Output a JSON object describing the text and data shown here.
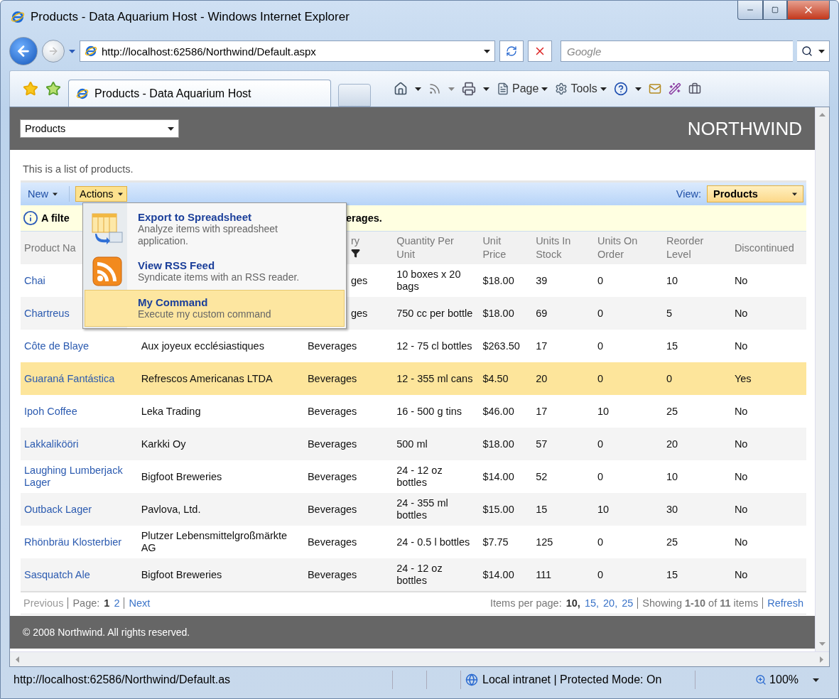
{
  "window": {
    "title": "Products - Data Aquarium Host - Windows Internet Explorer"
  },
  "address_bar": {
    "url": "http://localhost:62586/Northwind/Default.aspx"
  },
  "search": {
    "placeholder": "Google"
  },
  "tabs": [
    {
      "label": "Products - Data Aquarium Host",
      "selected": true
    }
  ],
  "command_bar": {
    "menus": [
      "Page",
      "Tools"
    ]
  },
  "page": {
    "table_picker": {
      "value": "Products"
    },
    "brand": "NORTHWIND",
    "description": "This is a list of products.",
    "toolbar": {
      "items": [
        {
          "label": "New",
          "selected": false
        },
        {
          "label": "Actions",
          "selected": true
        }
      ],
      "view_label": "View:",
      "view_value": "Products"
    },
    "actions_menu": [
      {
        "kind": "spreadsheet",
        "title": "Export to Spreadsheet",
        "description": "Analyze items with spreadsheet application.",
        "selected": false
      },
      {
        "kind": "rss",
        "title": "View RSS Feed",
        "description": "Syndicate items with an RSS reader.",
        "selected": false
      },
      {
        "kind": "plain",
        "title": "My Command",
        "description": "Execute my custom command",
        "selected": true
      }
    ],
    "filter_notice": {
      "text_start": "A filte",
      "text_end": "erages."
    },
    "table": {
      "columns": [
        {
          "label": "Product Na",
          "filtered": false
        },
        {
          "label": "ry",
          "filtered": true
        },
        {
          "label": "Quantity Per Unit",
          "filtered": false
        },
        {
          "label": "Unit Price",
          "filtered": false
        },
        {
          "label": "Units In Stock",
          "filtered": false
        },
        {
          "label": "Units On Order",
          "filtered": false
        },
        {
          "label": "Reorder Level",
          "filtered": false
        },
        {
          "label": "Discontinued",
          "filtered": false
        }
      ],
      "rows": [
        {
          "product": "Chai",
          "category": "ges",
          "quantity": "10 boxes x 20 bags",
          "price": "$18.00",
          "in_stock": "39",
          "on_order": "0",
          "reorder": "10",
          "discontinued": "No",
          "selected": false
        },
        {
          "product": "Chartreus",
          "category": "ges",
          "quantity": "750 cc per bottle",
          "price": "$18.00",
          "in_stock": "69",
          "on_order": "0",
          "reorder": "5",
          "discontinued": "No",
          "selected": false
        },
        {
          "product": "Côte de Blaye",
          "supplier": "Aux joyeux ecclésiastiques",
          "category": "Beverages",
          "quantity": "12 - 75 cl bottles",
          "price": "$263.50",
          "in_stock": "17",
          "on_order": "0",
          "reorder": "15",
          "discontinued": "No",
          "selected": false
        },
        {
          "product": "Guaraná Fantástica",
          "supplier": "Refrescos Americanas LTDA",
          "category": "Beverages",
          "quantity": "12 - 355 ml cans",
          "price": "$4.50",
          "in_stock": "20",
          "on_order": "0",
          "reorder": "0",
          "discontinued": "Yes",
          "selected": true
        },
        {
          "product": "Ipoh Coffee",
          "supplier": "Leka Trading",
          "category": "Beverages",
          "quantity": "16 - 500 g tins",
          "price": "$46.00",
          "in_stock": "17",
          "on_order": "10",
          "reorder": "25",
          "discontinued": "No",
          "selected": false
        },
        {
          "product": "Lakkalikööri",
          "supplier": "Karkki Oy",
          "category": "Beverages",
          "quantity": "500 ml",
          "price": "$18.00",
          "in_stock": "57",
          "on_order": "0",
          "reorder": "20",
          "discontinued": "No",
          "selected": false
        },
        {
          "product": "Laughing Lumberjack Lager",
          "supplier": "Bigfoot Breweries",
          "category": "Beverages",
          "quantity": "24 - 12 oz bottles",
          "price": "$14.00",
          "in_stock": "52",
          "on_order": "0",
          "reorder": "10",
          "discontinued": "No",
          "selected": false
        },
        {
          "product": "Outback Lager",
          "supplier": "Pavlova, Ltd.",
          "category": "Beverages",
          "quantity": "24 - 355 ml bottles",
          "price": "$15.00",
          "in_stock": "15",
          "on_order": "10",
          "reorder": "30",
          "discontinued": "No",
          "selected": false
        },
        {
          "product": "Rhönbräu Klosterbier",
          "supplier": "Plutzer Lebensmittelgroßmärkte AG",
          "category": "Beverages",
          "quantity": "24 - 0.5 l bottles",
          "price": "$7.75",
          "in_stock": "125",
          "on_order": "0",
          "reorder": "25",
          "discontinued": "No",
          "selected": false
        },
        {
          "product": "Sasquatch Ale",
          "supplier": "Bigfoot Breweries",
          "category": "Beverages",
          "quantity": "24 - 12 oz bottles",
          "price": "$14.00",
          "in_stock": "111",
          "on_order": "0",
          "reorder": "15",
          "discontinued": "No",
          "selected": false
        }
      ]
    },
    "pager": {
      "previous": {
        "label": "Previous",
        "disabled": true
      },
      "page_label": "Page:",
      "pages": [
        {
          "label": "1",
          "selected": true
        },
        {
          "label": "2",
          "selected": false
        }
      ],
      "next": {
        "label": "Next",
        "disabled": false
      },
      "items_per_page_label": "Items per page:",
      "page_sizes": [
        {
          "label": "10,",
          "selected": true
        },
        {
          "label": "15,",
          "selected": false
        },
        {
          "label": "20,",
          "selected": false
        },
        {
          "label": "25",
          "selected": false
        }
      ],
      "showing": "Showing **1-10** of **11** items",
      "refresh": "Refresh"
    },
    "footer": "© 2008 Northwind. All rights reserved."
  },
  "status_bar": {
    "url": "http://localhost:62586/Northwind/Default.as",
    "zone": "Local intranet | Protected Mode: On",
    "zoom": "100%"
  }
}
